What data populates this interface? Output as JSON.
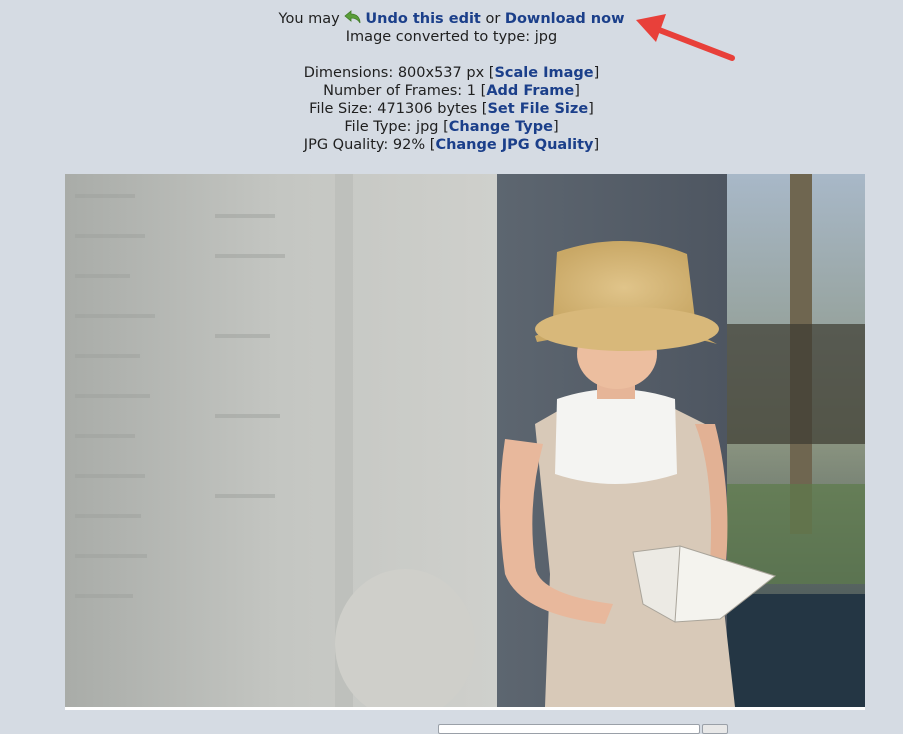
{
  "header": {
    "you_may": "You may",
    "undo_link": "Undo this edit",
    "or_text": "or",
    "download_link": "Download now",
    "converted_text": "Image converted to type: jpg"
  },
  "details": {
    "dimensions_text": "Dimensions: 800x537 px",
    "scale_link": "Scale Image",
    "frames_text": "Number of Frames: 1",
    "frame_link": "Add Frame",
    "filesize_text": "File Size: 471306 bytes",
    "filesize_link": "Set File Size",
    "filetype_text": "File Type: jpg",
    "filetype_link": "Change Type",
    "quality_text": "JPG Quality: 92%",
    "quality_link": "Change JPG Quality"
  },
  "colors": {
    "background": "#d5dbe3",
    "link": "#1b3f8a",
    "arrow": "#e8403a"
  },
  "icons": {
    "undo": "undo-arrow-icon",
    "annotation": "red-arrow-icon"
  }
}
